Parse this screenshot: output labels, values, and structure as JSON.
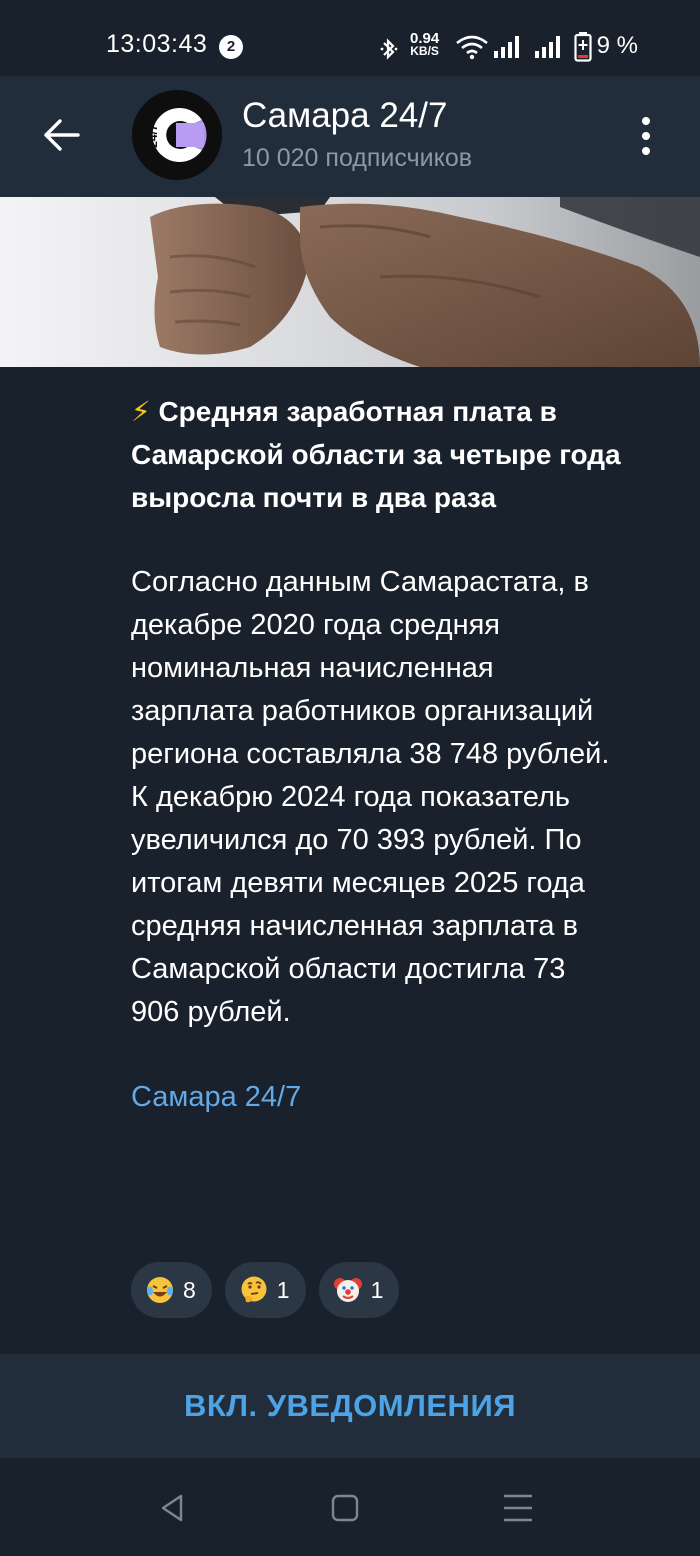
{
  "status_bar": {
    "time": "13:03:43",
    "notification_count": "2",
    "net_speed_value": "0.94",
    "net_speed_unit": "KB/S",
    "battery": "9 %"
  },
  "header": {
    "title": "Самара 24/7",
    "subtitle": "10 020 подписчиков",
    "avatar_text": "24/7"
  },
  "post": {
    "title_emoji": "⚡",
    "title": "Средняя заработная плата в Самарской области за четыре года выросла почти в два раза",
    "body": "Согласно данным Самарастата, в декабре 2020 года средняя номинальная начисленная зарплата работников организаций региона составляла 38 748 рублей. К декабрю 2024 года показатель увеличился до 70 393 рублей. По итогам девяти месяцев 2025 года средняя начисленная зарплата в Самарской области достигла 73 906 рублей.",
    "signature": "Самара 24/7"
  },
  "reactions": [
    {
      "emoji": "laughing-tears",
      "count": "8"
    },
    {
      "emoji": "thinking",
      "count": "1"
    },
    {
      "emoji": "clown",
      "count": "1"
    }
  ],
  "notify_button": "ВКЛ. УВЕДОМЛЕНИЯ",
  "colors": {
    "background": "#18212c",
    "header": "#212d3b",
    "accent": "#4da3e6",
    "link": "#64a9e5",
    "muted": "#8b98a6"
  }
}
